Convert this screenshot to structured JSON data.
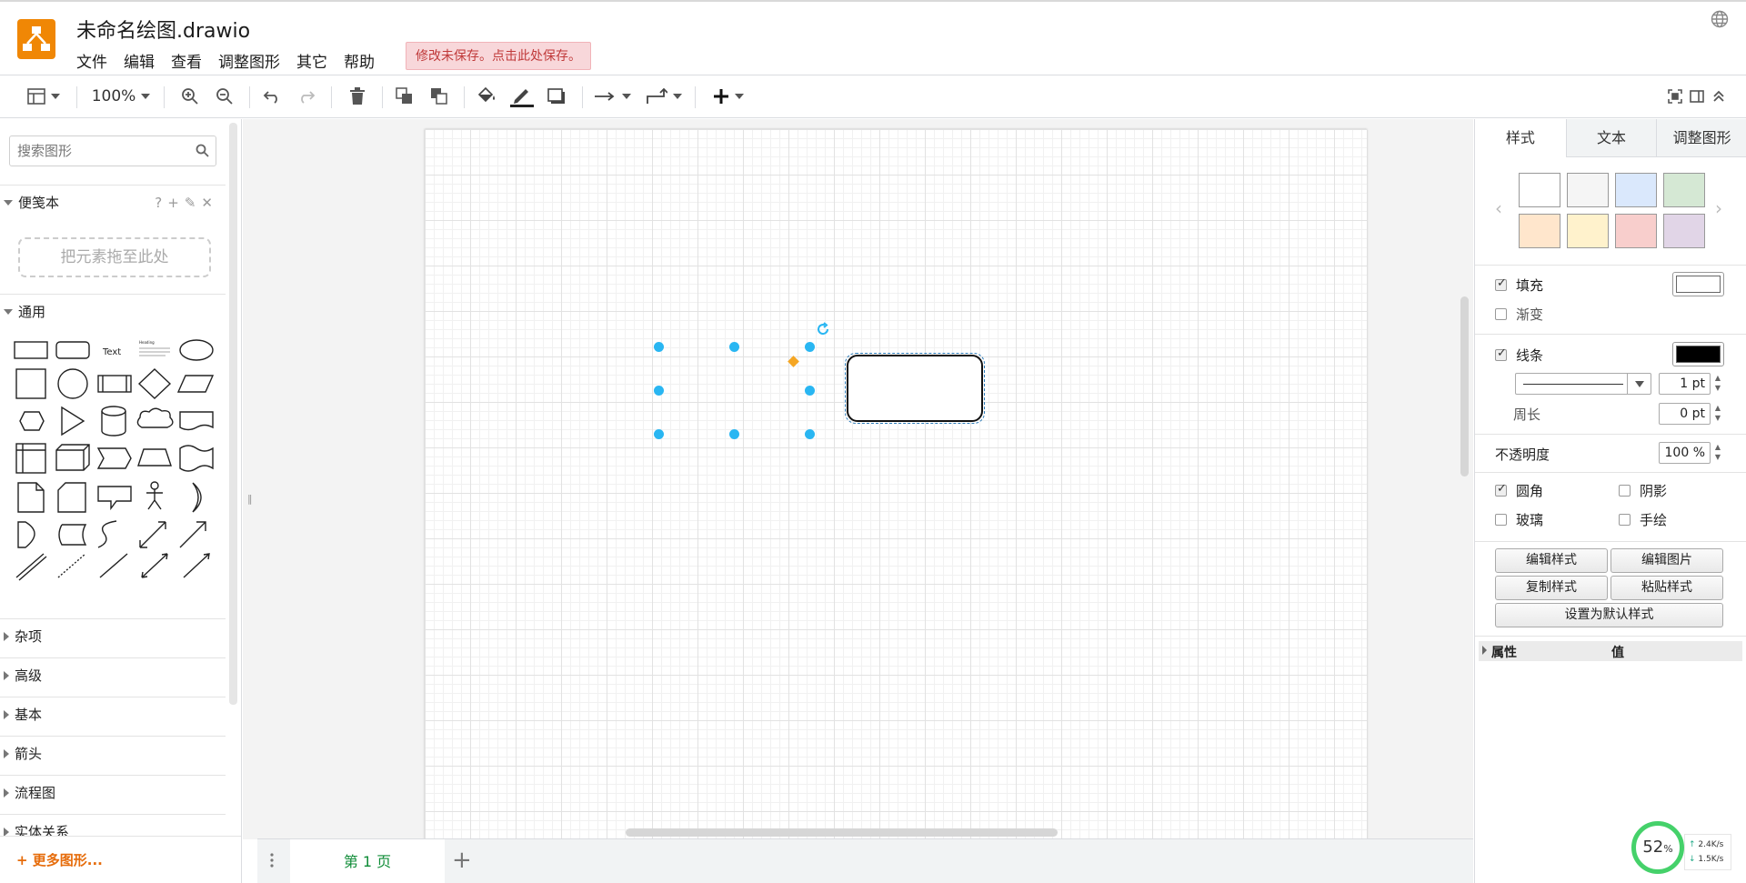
{
  "app": {
    "title": "未命名绘图.drawio",
    "unsaved_notice": "修改未保存。点击此处保存。"
  },
  "menu": [
    "文件",
    "编辑",
    "查看",
    "调整图形",
    "其它",
    "帮助"
  ],
  "toolbar": {
    "zoom": "100%"
  },
  "sidebar": {
    "search_placeholder": "搜索图形",
    "scratchpad_label": "便笺本",
    "dropzone_label": "把元素拖至此处",
    "general_label": "通用",
    "shape_text_label": "Text",
    "shape_heading_label": "Heading",
    "sections": [
      "杂项",
      "高级",
      "基本",
      "箭头",
      "流程图",
      "实体关系"
    ],
    "more_shapes": "+ 更多图形..."
  },
  "pages": {
    "current_tab": "第 1 页"
  },
  "format_panel": {
    "tabs": [
      "样式",
      "文本",
      "调整图形"
    ],
    "swatches": [
      "#ffffff",
      "#f5f5f5",
      "#dae8fc",
      "#d5e8d4",
      "#ffe6cc",
      "#fff2cc",
      "#f8cecc",
      "#e1d5e7"
    ],
    "fill_label": "填充",
    "fill_color": "#ffffff",
    "gradient_label": "渐变",
    "line_label": "线条",
    "line_color": "#000000",
    "line_width": "1 pt",
    "perimeter_label": "周长",
    "perimeter_value": "0 pt",
    "opacity_label": "不透明度",
    "opacity_value": "100 %",
    "rounded_label": "圆角",
    "shadow_label": "阴影",
    "glass_label": "玻璃",
    "sketch_label": "手绘",
    "edit_style": "编辑样式",
    "edit_image": "编辑图片",
    "copy_style": "复制样式",
    "paste_style": "粘贴样式",
    "set_default_style": "设置为默认样式",
    "property_col": "属性",
    "value_col": "值"
  },
  "network": {
    "percent": "52",
    "percent_sign": "%",
    "up": "2.4K/s",
    "down": "1.5K/s"
  },
  "colors": {
    "accent": "#f08705",
    "handle": "#29b6f2",
    "page_tab_text": "#0f8c37",
    "more_shapes_text": "#e66c0b"
  }
}
